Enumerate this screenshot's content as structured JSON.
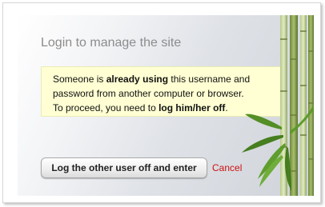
{
  "dialog": {
    "title": "Login to manage the site"
  },
  "notice": {
    "line1_prefix": "Someone is ",
    "line1_bold": "already using",
    "line1_suffix": " this username and",
    "line2": "password from another computer or browser.",
    "line3_prefix": "To proceed, you need to ",
    "line3_bold": "log him/her off",
    "line3_suffix": "."
  },
  "actions": {
    "primary_label": "Log the other user off and enter",
    "cancel_label": "Cancel"
  },
  "colors": {
    "title": "#8c8c8c",
    "notice_background": "#ffffd3",
    "cancel_link": "#cc1111"
  },
  "decoration": {
    "icon": "bamboo-illustration"
  }
}
